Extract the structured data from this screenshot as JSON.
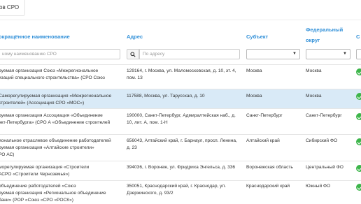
{
  "tab": {
    "label": "ов СРО"
  },
  "columns": {
    "name": "окращённое наименование",
    "address": "Адрес",
    "subject": "Субъект",
    "fo_line1": "Федеральный",
    "fo_line2": "округ",
    "status": "С"
  },
  "filters": {
    "name_placeholder": "ному наименованию СРО",
    "address_placeholder": "По адресу",
    "subject_value": "",
    "fo_value": ""
  },
  "rows": [
    {
      "name": [
        "руемая организация Союз «Межрегиональное",
        "изаций специального строительства» (СРО Союз"
      ],
      "address": [
        "129164, г. Москва, ул. Маломосковская, д. 10, эт. 4,",
        "пом. 13"
      ],
      "subject": "Москва",
      "fo": "Москва",
      "status": "active"
    },
    {
      "name": [
        "Саморегулируемая организация «Межрегиональное",
        "строителей» (Ассоциация СРО «МОС»)"
      ],
      "address": [
        "117588, Москва, ул. Тарусская, д. 10"
      ],
      "subject": "Москва",
      "fo": "Москва",
      "status": "active"
    },
    {
      "name": [
        "руемая организация Ассоциация «Объединение",
        "нкт-Петербурга» (СРО А «Объединение строителей"
      ],
      "address": [
        "190000, Санкт-Петербург, Адмиралтейская наб., д.",
        "10, лит. А, пом. 1-Н"
      ],
      "subject": "Санкт-Петербург",
      "fo": "Санкт-Петербург",
      "status": "active"
    },
    {
      "name": [
        "иональное отраслевое объединение работодателей",
        "руемая организация «Алтайские строители»",
        "РО АС)"
      ],
      "address": [
        "656043, Алтайский край, г. Барнаул, просп. Ленина,",
        "д. 23"
      ],
      "subject": "Алтайский край",
      "fo": "Сибирский ФО",
      "status": "active"
    },
    {
      "name": [
        "морегулируемая организация «Строители",
        "АСРО «Строители Черноземья»)"
      ],
      "address": [
        "394036, г. Воронеж, ул. Фридриха Энгельса, д. 336"
      ],
      "subject": "Воронежская область",
      "fo": "Центральный ФО",
      "status": "active"
    },
    {
      "name": [
        "объединение работодателей «Союз",
        "руемая организация «Региональное объединение",
        "бани» (РОР «Союз «СРО «РОСК»)"
      ],
      "address": [
        "350051, Краснодарский край, г. Краснодар, ул.",
        "Дзержинского, д. 93/2"
      ],
      "subject": "Краснодарский край",
      "fo": "Южный ФО",
      "status": "active"
    }
  ]
}
